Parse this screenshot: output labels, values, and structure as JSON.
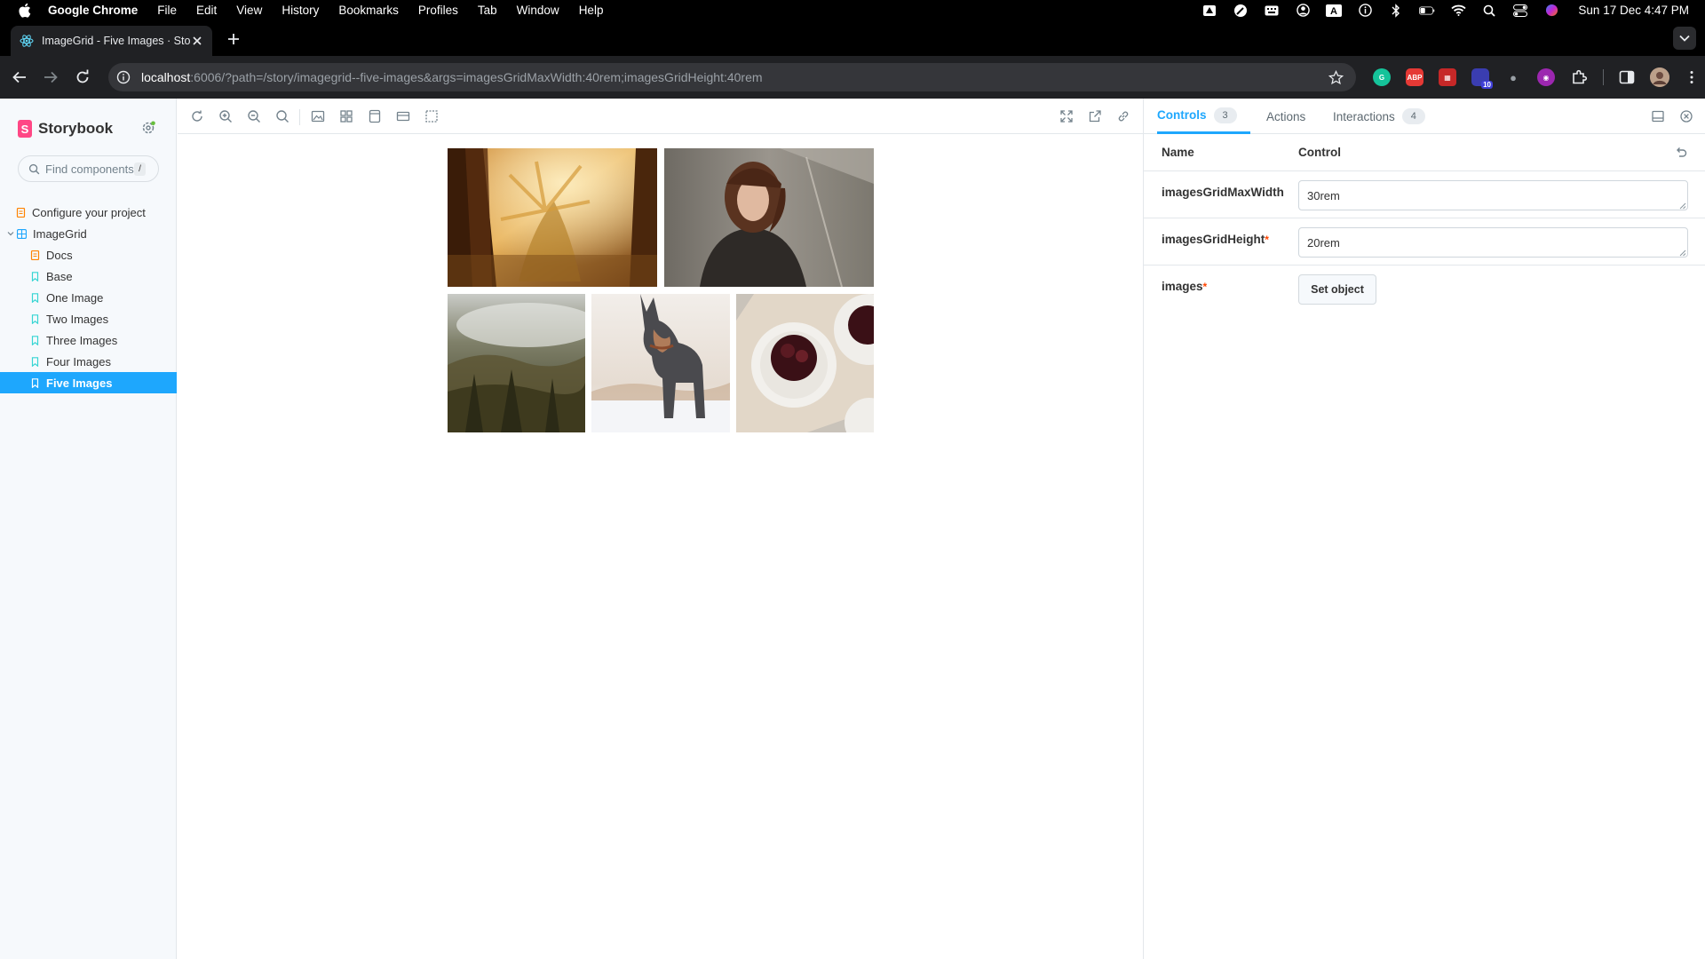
{
  "menubar": {
    "app_name": "Google Chrome",
    "items": [
      "File",
      "Edit",
      "View",
      "History",
      "Bookmarks",
      "Profiles",
      "Tab",
      "Window",
      "Help"
    ],
    "clock": "Sun 17 Dec  4:47 PM"
  },
  "browser": {
    "tab_title": "ImageGrid - Five Images · Storybook",
    "url_host": "localhost",
    "url_path": ":6006/?path=/story/imagegrid--five-images&args=imagesGridMaxWidth:40rem;imagesGridHeight:40rem",
    "extension_badge": "10",
    "abp_label": "ABP"
  },
  "sidebar": {
    "brand": "Storybook",
    "brand_initial": "S",
    "search_placeholder": "Find components",
    "search_shortcut": "/",
    "items": [
      {
        "label": "Configure your project",
        "type": "doc"
      },
      {
        "label": "ImageGrid",
        "type": "component"
      },
      {
        "label": "Docs",
        "type": "doc"
      },
      {
        "label": "Base",
        "type": "story"
      },
      {
        "label": "One Image",
        "type": "story"
      },
      {
        "label": "Two Images",
        "type": "story"
      },
      {
        "label": "Three Images",
        "type": "story"
      },
      {
        "label": "Four Images",
        "type": "story"
      },
      {
        "label": "Five Images",
        "type": "story",
        "selected": true
      }
    ]
  },
  "preview": {
    "images": [
      {
        "name": "palm-trees-image"
      },
      {
        "name": "woman-umbrella-image"
      },
      {
        "name": "misty-forest-image"
      },
      {
        "name": "dog-snow-image"
      },
      {
        "name": "cake-plates-image"
      }
    ]
  },
  "panel": {
    "tabs": [
      {
        "label": "Controls",
        "count": "3",
        "active": true
      },
      {
        "label": "Actions"
      },
      {
        "label": "Interactions",
        "count": "4"
      }
    ],
    "col_name": "Name",
    "col_control": "Control",
    "rows": [
      {
        "name": "imagesGridMaxWidth",
        "value": "30rem",
        "required": false
      },
      {
        "name": "imagesGridHeight",
        "value": "20rem",
        "required": true
      },
      {
        "name": "images",
        "button": "Set object",
        "required": true
      }
    ],
    "required_mark": "*"
  },
  "colors": {
    "accent": "#1ea7fd",
    "storybook_pink": "#ff4785",
    "required": "#ff4400"
  }
}
